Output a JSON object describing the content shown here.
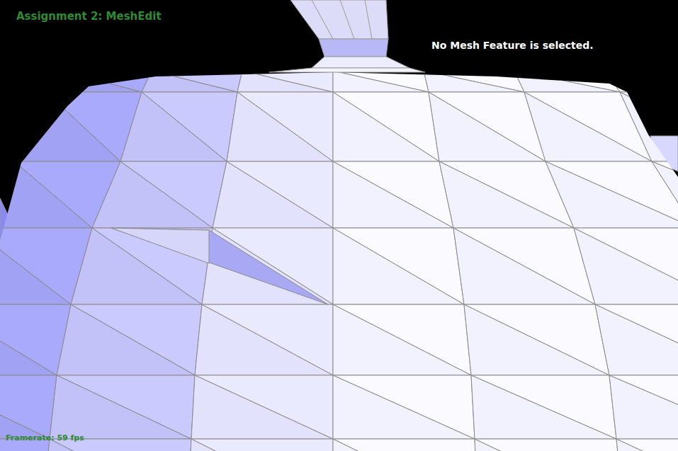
{
  "app": {
    "title": "Assignment 2: MeshEdit"
  },
  "status": {
    "selection": "No Mesh Feature is selected."
  },
  "footer": {
    "framerate": "Framerate: 59 fps"
  }
}
